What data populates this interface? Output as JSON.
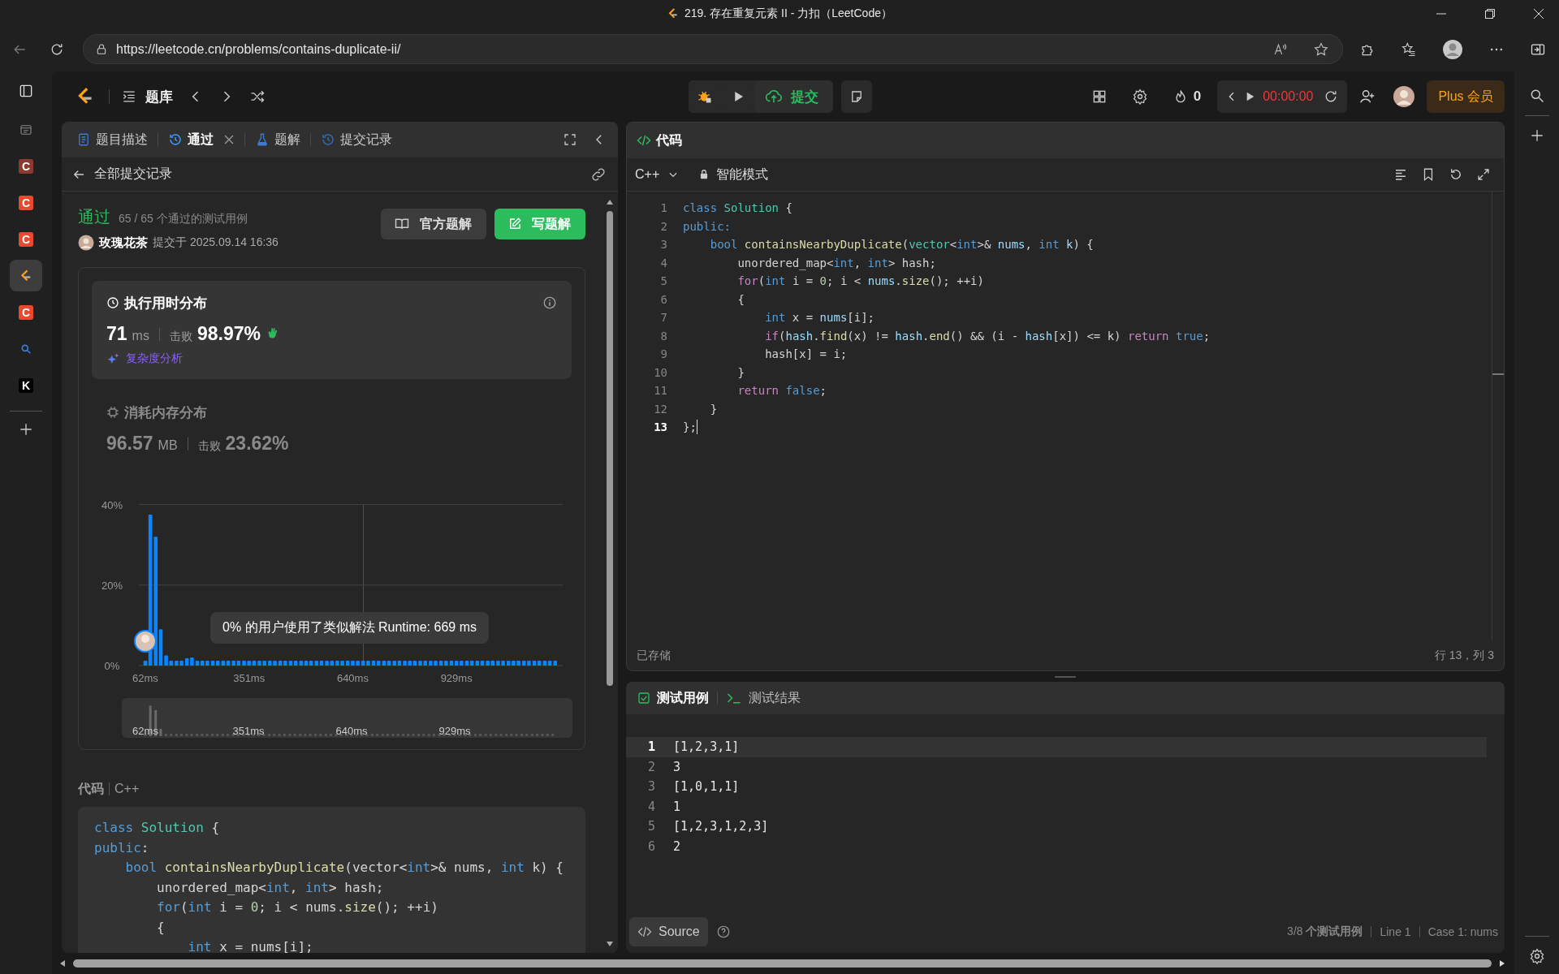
{
  "browser": {
    "title": "219. 存在重复元素 II - 力扣（LeetCode）",
    "url": "https://leetcode.cn/problems/contains-duplicate-ii/"
  },
  "vertical_tabs": [
    {
      "kind": "page",
      "selected": false
    },
    {
      "kind": "letter",
      "letter": "C",
      "color": "#8c3a30",
      "selected": false
    },
    {
      "kind": "letter",
      "letter": "C",
      "color": "#e8492f",
      "selected": false
    },
    {
      "kind": "letter",
      "letter": "C",
      "color": "#e8492f",
      "selected": false
    },
    {
      "kind": "site",
      "selected": true
    },
    {
      "kind": "letter",
      "letter": "C",
      "color": "#e8492f",
      "selected": false
    },
    {
      "kind": "search",
      "selected": false
    },
    {
      "kind": "letter",
      "letter": "K",
      "color": "#000000",
      "selected": false
    }
  ],
  "nav": {
    "problem_list": "题库",
    "submit": "提交",
    "streak": "0",
    "timer": "00:00:00",
    "plus": "Plus 会员"
  },
  "left_tabs": [
    {
      "label": "题目描述",
      "kind": "doc",
      "selected": false,
      "closable": false
    },
    {
      "label": "通过",
      "kind": "history",
      "selected": true,
      "closable": true
    },
    {
      "label": "题解",
      "kind": "flask",
      "selected": false,
      "closable": false
    },
    {
      "label": "提交记录",
      "kind": "history",
      "selected": false,
      "closable": false
    }
  ],
  "submission": {
    "back_label": "全部提交记录",
    "status": "通过",
    "passed": "65 / 65 个通过的测试用例",
    "user": "玫瑰花茶",
    "submitted": "提交于 2025.09.14 16:36",
    "buttons": [
      {
        "label": "官方题解",
        "kind": "secondary"
      },
      {
        "label": "写题解",
        "kind": "primary"
      }
    ]
  },
  "runtime": {
    "title": "执行用时分布",
    "selected": true,
    "value": "71",
    "unit": "ms",
    "beats_label": "击败",
    "beats": "98.97%",
    "analysis": "复杂度分析"
  },
  "memory": {
    "title": "消耗内存分布",
    "selected": false,
    "value": "96.57",
    "unit": "MB",
    "beats_label": "击败",
    "beats": "23.62%"
  },
  "distribution": {
    "tooltip": "0% 的用户使用了类似解法 Runtime: 669 ms",
    "brush_labels": [
      "62ms",
      "351ms",
      "640ms",
      "929ms"
    ],
    "chart_data": {
      "type": "bar",
      "xlim": [
        44,
        1225
      ],
      "ylim": [
        0,
        40
      ],
      "yticks": [
        {
          "value": 0,
          "label": "0%"
        },
        {
          "value": 20,
          "label": "20%"
        },
        {
          "value": 40,
          "label": "40%"
        }
      ],
      "xticks": [
        {
          "value": 62,
          "label": "62ms"
        },
        {
          "value": 351,
          "label": "351ms"
        },
        {
          "value": 640,
          "label": "640ms"
        },
        {
          "value": 929,
          "label": "929ms"
        }
      ],
      "x": [
        62,
        76,
        91,
        105,
        120,
        134,
        149,
        163,
        178,
        192,
        207,
        221,
        235,
        250,
        264,
        279,
        293,
        308,
        322,
        337,
        351,
        365,
        380,
        394,
        409,
        423,
        438,
        452,
        467,
        481,
        496,
        510,
        524,
        539,
        553,
        568,
        582,
        597,
        611,
        626,
        640,
        654,
        669,
        683,
        698,
        712,
        727,
        741,
        756,
        770,
        785,
        799,
        813,
        828,
        842,
        857,
        871,
        886,
        900,
        915,
        929,
        943,
        958,
        972,
        987,
        1001,
        1016,
        1030,
        1045,
        1059,
        1074,
        1088,
        1102,
        1117,
        1131,
        1146,
        1160,
        1175,
        1189,
        1204
      ],
      "values": [
        1.2,
        37.5,
        32,
        9,
        2.5,
        1.2,
        1.2,
        1.2,
        1.8,
        2,
        1.2,
        1.2,
        1.2,
        1.2,
        1.2,
        1.2,
        1.2,
        1.2,
        1.2,
        1.2,
        1.2,
        1.2,
        1.2,
        1.2,
        1.2,
        1.2,
        1.2,
        1.2,
        1.2,
        1.2,
        1.2,
        1.2,
        1.2,
        1.2,
        1.2,
        1.2,
        1.2,
        1.2,
        1.2,
        1.2,
        1.2,
        1.2,
        1.2,
        1.2,
        1.2,
        1.2,
        1.2,
        1.2,
        1.2,
        1.2,
        1.2,
        1.2,
        1.2,
        1.2,
        1.2,
        1.2,
        1.2,
        1.2,
        1.2,
        1.2,
        1.2,
        1.2,
        1.2,
        1.2,
        1.2,
        1.2,
        1.2,
        1.2,
        1.2,
        1.2,
        1.2,
        1.2,
        1.2,
        1.2,
        1.2,
        1.2,
        1.2,
        1.2,
        1.2,
        1.2
      ]
    }
  },
  "code_view": {
    "title": "代码",
    "language": "C++",
    "lines": [
      [
        {
          "text": "class",
          "kind": "keyword"
        },
        {
          "text": " Solution",
          "kind": "type"
        },
        {
          "text": " {",
          "kind": "plain"
        }
      ],
      [
        {
          "text": "public",
          "kind": "keyword"
        },
        {
          "text": ":",
          "kind": "plain"
        }
      ],
      [
        {
          "text": "    bool",
          "kind": "keyword"
        },
        {
          "text": " containsNearbyDuplicate",
          "kind": "function"
        },
        {
          "text": "(vector<",
          "kind": "plain"
        },
        {
          "text": "int",
          "kind": "keyword"
        },
        {
          "text": ">& nums, ",
          "kind": "plain"
        },
        {
          "text": "int",
          "kind": "keyword"
        },
        {
          "text": " k) {",
          "kind": "plain"
        }
      ],
      [
        {
          "text": "        unordered_map<",
          "kind": "plain"
        },
        {
          "text": "int",
          "kind": "keyword"
        },
        {
          "text": ", ",
          "kind": "plain"
        },
        {
          "text": "int",
          "kind": "keyword"
        },
        {
          "text": "> hash;",
          "kind": "plain"
        }
      ],
      [
        {
          "text": "        for",
          "kind": "keyword"
        },
        {
          "text": "(",
          "kind": "plain"
        },
        {
          "text": "int",
          "kind": "keyword"
        },
        {
          "text": " i = ",
          "kind": "plain"
        },
        {
          "text": "0",
          "kind": "number"
        },
        {
          "text": "; i < nums.",
          "kind": "plain"
        },
        {
          "text": "size",
          "kind": "function"
        },
        {
          "text": "(); ++i)",
          "kind": "plain"
        }
      ],
      [
        {
          "text": "        {",
          "kind": "plain"
        }
      ],
      [
        {
          "text": "            int",
          "kind": "keyword"
        },
        {
          "text": " x = nums[i];",
          "kind": "plain"
        }
      ]
    ]
  },
  "editor": {
    "title": "代码",
    "language": "C++",
    "mode": "智能模式",
    "status": "已存储",
    "cursor": "行 13，列 3",
    "lines": [
      {
        "number": "1",
        "current": false,
        "tokens": [
          {
            "text": "class",
            "kind": "keyword"
          },
          {
            "text": " Solution",
            "kind": "type"
          },
          {
            "text": " {",
            "kind": "plain"
          }
        ]
      },
      {
        "number": "2",
        "current": false,
        "tokens": [
          {
            "text": "public:",
            "kind": "keyword"
          }
        ]
      },
      {
        "number": "3",
        "current": false,
        "tokens": [
          {
            "text": "    bool",
            "kind": "keyword"
          },
          {
            "text": " containsNearbyDuplicate",
            "kind": "function"
          },
          {
            "text": "(",
            "kind": "plain"
          },
          {
            "text": "vector",
            "kind": "type"
          },
          {
            "text": "<",
            "kind": "plain"
          },
          {
            "text": "int",
            "kind": "keyword"
          },
          {
            "text": ">& ",
            "kind": "plain"
          },
          {
            "text": "nums",
            "kind": "variable"
          },
          {
            "text": ", ",
            "kind": "plain"
          },
          {
            "text": "int",
            "kind": "keyword"
          },
          {
            "text": " k",
            "kind": "variable"
          },
          {
            "text": ") {",
            "kind": "plain"
          }
        ]
      },
      {
        "number": "4",
        "current": false,
        "tokens": [
          {
            "text": "        unordered_map<",
            "kind": "plain"
          },
          {
            "text": "int",
            "kind": "keyword"
          },
          {
            "text": ", ",
            "kind": "plain"
          },
          {
            "text": "int",
            "kind": "keyword"
          },
          {
            "text": "> hash;",
            "kind": "plain"
          }
        ]
      },
      {
        "number": "5",
        "current": false,
        "tokens": [
          {
            "text": "        for",
            "kind": "control"
          },
          {
            "text": "(",
            "kind": "plain"
          },
          {
            "text": "int",
            "kind": "keyword"
          },
          {
            "text": " i = ",
            "kind": "plain"
          },
          {
            "text": "0",
            "kind": "number"
          },
          {
            "text": "; i < ",
            "kind": "plain"
          },
          {
            "text": "nums",
            "kind": "variable"
          },
          {
            "text": ".",
            "kind": "plain"
          },
          {
            "text": "size",
            "kind": "function"
          },
          {
            "text": "(); ++i)",
            "kind": "plain"
          }
        ]
      },
      {
        "number": "6",
        "current": false,
        "tokens": [
          {
            "text": "        {",
            "kind": "plain"
          }
        ]
      },
      {
        "number": "7",
        "current": false,
        "tokens": [
          {
            "text": "            int",
            "kind": "keyword"
          },
          {
            "text": " x = ",
            "kind": "plain"
          },
          {
            "text": "nums",
            "kind": "variable"
          },
          {
            "text": "[i];",
            "kind": "plain"
          }
        ]
      },
      {
        "number": "8",
        "current": false,
        "tokens": [
          {
            "text": "            if",
            "kind": "control"
          },
          {
            "text": "(",
            "kind": "plain"
          },
          {
            "text": "hash",
            "kind": "variable"
          },
          {
            "text": ".",
            "kind": "plain"
          },
          {
            "text": "find",
            "kind": "function"
          },
          {
            "text": "(x) != ",
            "kind": "plain"
          },
          {
            "text": "hash",
            "kind": "variable"
          },
          {
            "text": ".",
            "kind": "plain"
          },
          {
            "text": "end",
            "kind": "function"
          },
          {
            "text": "() && (i - ",
            "kind": "plain"
          },
          {
            "text": "hash",
            "kind": "variable"
          },
          {
            "text": "[x]) <= k) ",
            "kind": "plain"
          },
          {
            "text": "return",
            "kind": "control"
          },
          {
            "text": " true",
            "kind": "keyword"
          },
          {
            "text": ";",
            "kind": "plain"
          }
        ]
      },
      {
        "number": "9",
        "current": false,
        "tokens": [
          {
            "text": "            hash[x] = i;",
            "kind": "plain"
          }
        ]
      },
      {
        "number": "10",
        "current": false,
        "tokens": [
          {
            "text": "        }",
            "kind": "plain"
          }
        ]
      },
      {
        "number": "11",
        "current": false,
        "tokens": [
          {
            "text": "        return",
            "kind": "control"
          },
          {
            "text": " false",
            "kind": "keyword"
          },
          {
            "text": ";",
            "kind": "plain"
          }
        ]
      },
      {
        "number": "12",
        "current": false,
        "tokens": [
          {
            "text": "    }",
            "kind": "plain"
          }
        ]
      },
      {
        "number": "13",
        "current": true,
        "tokens": [
          {
            "text": "};",
            "kind": "plain"
          }
        ]
      }
    ]
  },
  "testcases": {
    "tabs": [
      {
        "label": "测试用例",
        "kind": "check",
        "selected": true
      },
      {
        "label": "测试结果",
        "kind": "terminal",
        "selected": false
      }
    ],
    "lines": [
      {
        "number": "1",
        "text": "[1,2,3,1]",
        "current": true
      },
      {
        "number": "2",
        "text": "3",
        "current": false
      },
      {
        "number": "3",
        "text": "[1,0,1,1]",
        "current": false
      },
      {
        "number": "4",
        "text": "1",
        "current": false
      },
      {
        "number": "5",
        "text": "[1,2,3,1,2,3]",
        "current": false
      },
      {
        "number": "6",
        "text": "2",
        "current": false
      }
    ],
    "source_button": "Source",
    "footer": [
      "3/8 **个测试用例**",
      "Line 1",
      "Case 1: nums"
    ]
  }
}
